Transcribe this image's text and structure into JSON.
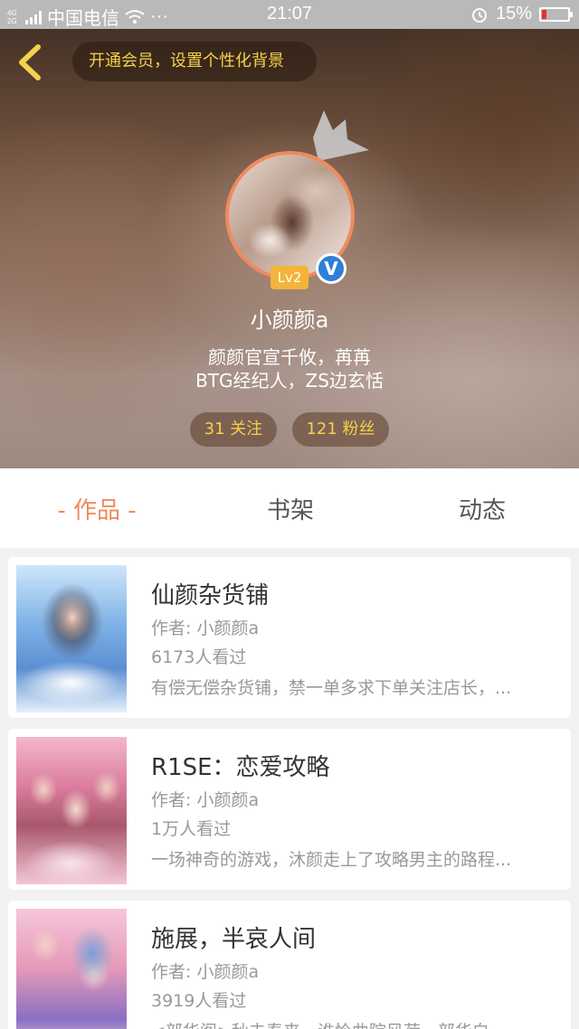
{
  "status_bar": {
    "network": "4G 2G",
    "carrier": "中国电信",
    "more": "···",
    "time": "21:07",
    "battery": "15%"
  },
  "header": {
    "vip_prompt": "开通会员，设置个性化背景"
  },
  "profile": {
    "level": "Lv2",
    "verified_mark": "V",
    "name": "小颜颜a",
    "bio_line1": "颜颜官宣千攸，苒苒",
    "bio_line2": "BTG经纪人，ZS边玄恬",
    "following": "31 关注",
    "followers": "121 粉丝"
  },
  "tabs": [
    {
      "label": "- 作品 -",
      "active": true
    },
    {
      "label": "书架",
      "active": false
    },
    {
      "label": "动态",
      "active": false
    }
  ],
  "books": [
    {
      "title": "仙颜杂货铺",
      "author": "作者: 小颜颜a",
      "views": "6173人看过",
      "desc": "有偿无偿杂货铺，禁一单多求下单关注店长，..."
    },
    {
      "title": "R1SE：恋爱攻略",
      "author": "作者: 小颜颜a",
      "views": "1万人看过",
      "desc": "一场神奇的游戏，沐颜走上了攻略男主的路程..."
    },
    {
      "title": "施展，半哀人间",
      "author": "作者: 小颜颜a",
      "views": "3919人看过",
      "desc": "<部华阁>秋去春来，谁怜曲院风荷，部华白..."
    }
  ],
  "colors": {
    "accent": "#f08a5d",
    "gold": "#f4d14a",
    "verified": "#2e7fd6"
  }
}
